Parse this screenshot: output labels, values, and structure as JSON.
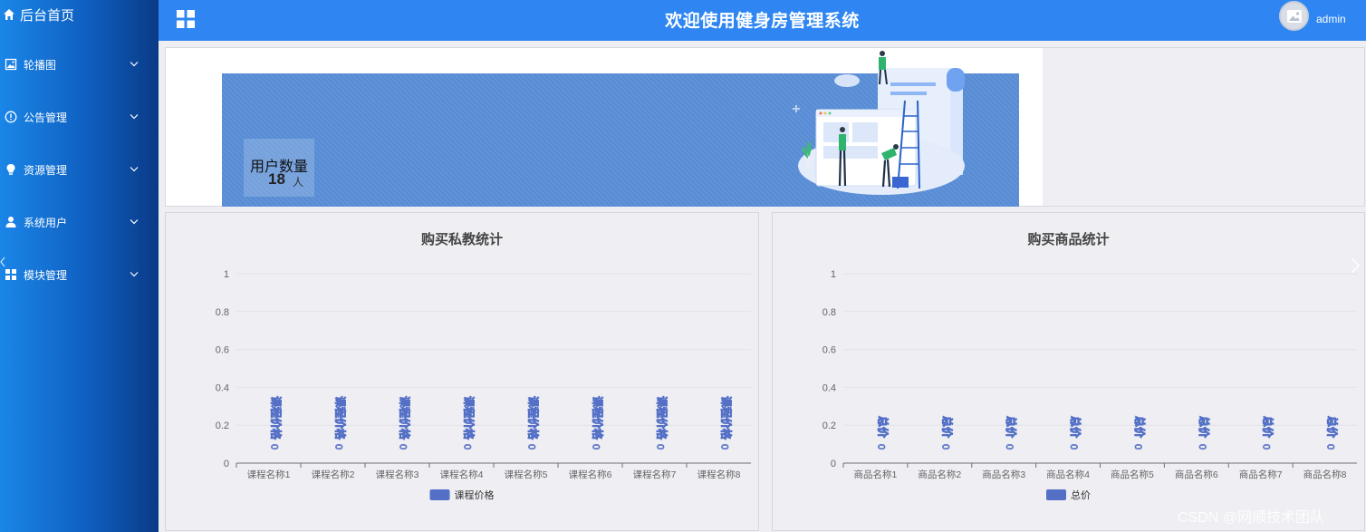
{
  "header": {
    "title": "欢迎使用健身房管理系统",
    "user": "admin"
  },
  "sidebar": {
    "home_label": "后台首页",
    "items": [
      {
        "label": "轮播图",
        "icon": "image-icon"
      },
      {
        "label": "公告管理",
        "icon": "info-icon"
      },
      {
        "label": "资源管理",
        "icon": "bulb-icon"
      },
      {
        "label": "系统用户",
        "icon": "user-icon"
      },
      {
        "label": "模块管理",
        "icon": "grid-icon"
      }
    ]
  },
  "stat": {
    "label": "用户数量",
    "value": "18",
    "unit": "人"
  },
  "chart_data": [
    {
      "type": "bar",
      "title": "购买私教统计",
      "categories": [
        "课程名称1",
        "课程名称2",
        "课程名称3",
        "课程名称4",
        "课程名称5",
        "课程名称6",
        "课程名称7",
        "课程名称8"
      ],
      "series": [
        {
          "name": "课程价格",
          "values": [
            0,
            0,
            0,
            0,
            0,
            0,
            0,
            0
          ],
          "color": "#5470c6"
        }
      ],
      "ylim": [
        0,
        1
      ],
      "yticks": [
        "0",
        "0.2",
        "0.4",
        "0.6",
        "0.8",
        "1"
      ],
      "data_labels": [
        "0",
        "0",
        "0",
        "0",
        "0",
        "0",
        "0",
        "0"
      ],
      "grid": true,
      "legend": "bottom-center"
    },
    {
      "type": "bar",
      "title": "购买商品统计",
      "categories": [
        "商品名称1",
        "商品名称2",
        "商品名称3",
        "商品名称4",
        "商品名称5",
        "商品名称6",
        "商品名称7",
        "商品名称8"
      ],
      "series": [
        {
          "name": "总价",
          "values": [
            0,
            0,
            0,
            0,
            0,
            0,
            0,
            0
          ],
          "color": "#5470c6"
        }
      ],
      "ylim": [
        0,
        1
      ],
      "yticks": [
        "0",
        "0.2",
        "0.4",
        "0.6",
        "0.8",
        "1"
      ],
      "data_labels": [
        "0",
        "0",
        "0",
        "0",
        "0",
        "0",
        "0",
        "0"
      ],
      "grid": true,
      "legend": "bottom-center"
    }
  ],
  "watermark": "CSDN @网顺技术团队"
}
